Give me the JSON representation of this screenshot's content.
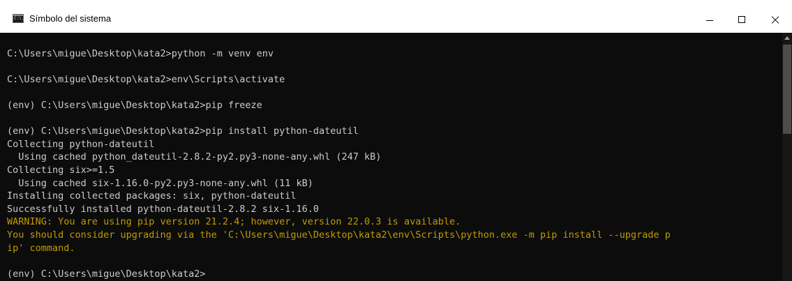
{
  "window": {
    "title": "Símbolo del sistema",
    "icon_label": "C:\\."
  },
  "console": {
    "lines": [
      {
        "text": "",
        "type": "normal"
      },
      {
        "text": "C:\\Users\\migue\\Desktop\\kata2>python -m venv env",
        "type": "normal"
      },
      {
        "text": "",
        "type": "normal"
      },
      {
        "text": "C:\\Users\\migue\\Desktop\\kata2>env\\Scripts\\activate",
        "type": "normal"
      },
      {
        "text": "",
        "type": "normal"
      },
      {
        "text": "(env) C:\\Users\\migue\\Desktop\\kata2>pip freeze",
        "type": "normal"
      },
      {
        "text": "",
        "type": "normal"
      },
      {
        "text": "(env) C:\\Users\\migue\\Desktop\\kata2>pip install python-dateutil",
        "type": "normal"
      },
      {
        "text": "Collecting python-dateutil",
        "type": "normal"
      },
      {
        "text": "  Using cached python_dateutil-2.8.2-py2.py3-none-any.whl (247 kB)",
        "type": "normal"
      },
      {
        "text": "Collecting six>=1.5",
        "type": "normal"
      },
      {
        "text": "  Using cached six-1.16.0-py2.py3-none-any.whl (11 kB)",
        "type": "normal"
      },
      {
        "text": "Installing collected packages: six, python-dateutil",
        "type": "normal"
      },
      {
        "text": "Successfully installed python-dateutil-2.8.2 six-1.16.0",
        "type": "normal"
      },
      {
        "text": "WARNING: You are using pip version 21.2.4; however, version 22.0.3 is available.",
        "type": "warn"
      },
      {
        "text": "You should consider upgrading via the 'C:\\Users\\migue\\Desktop\\kata2\\env\\Scripts\\python.exe -m pip install --upgrade p",
        "type": "warn"
      },
      {
        "text": "ip' command.",
        "type": "warn"
      },
      {
        "text": "",
        "type": "normal"
      },
      {
        "text": "(env) C:\\Users\\migue\\Desktop\\kata2>",
        "type": "normal"
      }
    ]
  },
  "colors": {
    "background": "#0c0c0c",
    "text": "#cccccc",
    "warning": "#c19c00",
    "titlebar": "#ffffff"
  },
  "icons": {
    "app": "cmd-icon",
    "minimize": "minimize-icon",
    "maximize": "maximize-icon",
    "close": "close-icon"
  }
}
